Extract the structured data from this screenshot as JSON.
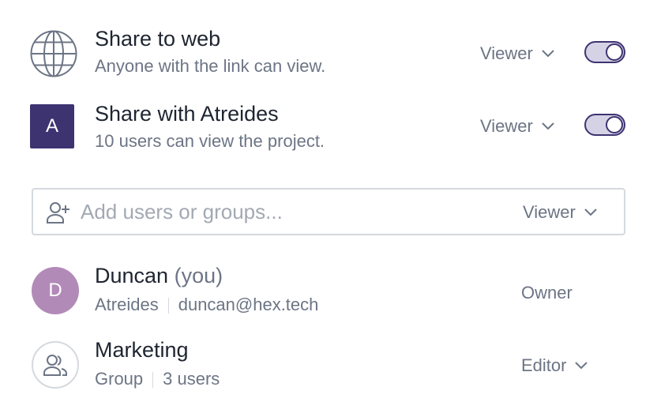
{
  "share_web": {
    "title": "Share to web",
    "subtitle": "Anyone with the link can view.",
    "role": "Viewer",
    "icon": "globe-icon",
    "enabled": true
  },
  "share_org": {
    "badge": "A",
    "title": "Share with Atreides",
    "subtitle": "10 users can view the project.",
    "role": "Viewer",
    "enabled": true
  },
  "add_users": {
    "placeholder": "Add users or groups...",
    "role": "Viewer",
    "icon": "add-user-icon"
  },
  "members": [
    {
      "avatar": "D",
      "name": "Duncan",
      "name_suffix": "(you)",
      "org": "Atreides",
      "email": "duncan@hex.tech",
      "role": "Owner"
    },
    {
      "avatar_icon": "group-icon",
      "name": "Marketing",
      "type": "Group",
      "count": "3 users",
      "role": "Editor"
    }
  ],
  "colors": {
    "accent": "#3e3371",
    "toggle_track": "#d6d2e6",
    "user_avatar": "#b28ab8",
    "text": "#1e2530",
    "muted": "#6c7585"
  }
}
